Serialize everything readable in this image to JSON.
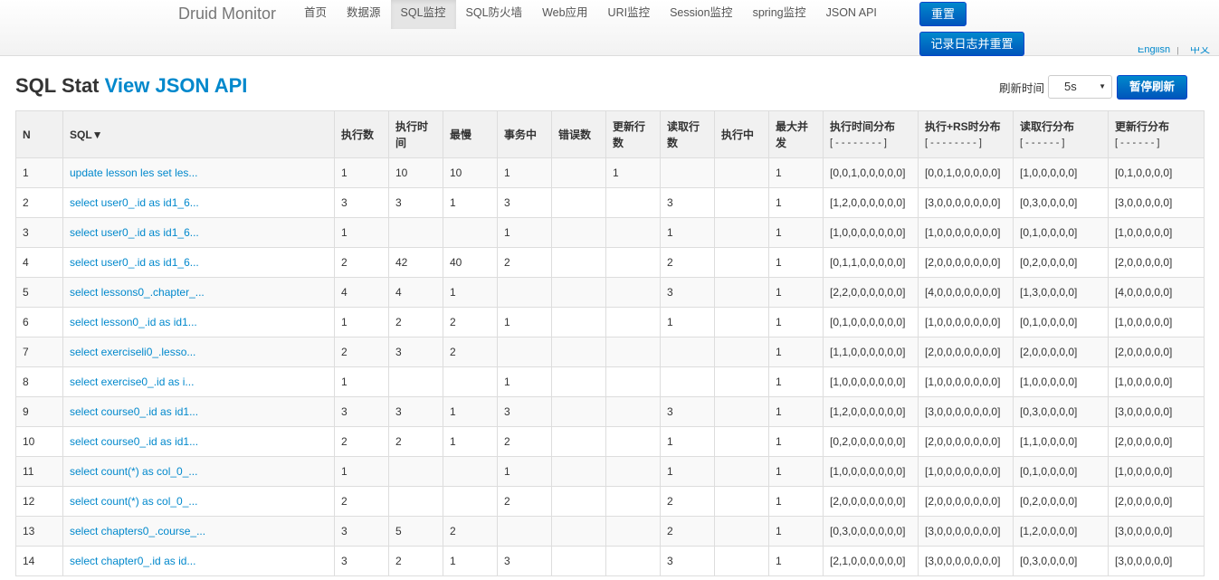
{
  "navbar": {
    "brand": "Druid Monitor",
    "items": [
      "首页",
      "数据源",
      "SQL监控",
      "SQL防火墙",
      "Web应用",
      "URI监控",
      "Session监控",
      "spring监控",
      "JSON API"
    ],
    "active_index": 2,
    "reset_label": "重置",
    "reset_log_label": "记录日志并重置",
    "lang_en": "English",
    "lang_sep": "|",
    "lang_zh": "中文"
  },
  "heading": {
    "title": "SQL Stat",
    "link": "View JSON API"
  },
  "refresh": {
    "label": "刷新时间",
    "selected": "5s",
    "pause_label": "暂停刷新"
  },
  "table": {
    "columns": [
      {
        "label": "N",
        "sub": ""
      },
      {
        "label": "SQL▼",
        "sub": ""
      },
      {
        "label": "执行数",
        "sub": ""
      },
      {
        "label": "执行时间",
        "sub": ""
      },
      {
        "label": "最慢",
        "sub": ""
      },
      {
        "label": "事务中",
        "sub": ""
      },
      {
        "label": "错误数",
        "sub": ""
      },
      {
        "label": "更新行数",
        "sub": ""
      },
      {
        "label": "读取行数",
        "sub": ""
      },
      {
        "label": "执行中",
        "sub": ""
      },
      {
        "label": "最大并发",
        "sub": ""
      },
      {
        "label": "执行时间分布",
        "sub": "[ - - - - - - - - ]"
      },
      {
        "label": "执行+RS时分布",
        "sub": "[ - - - - - - - - ]"
      },
      {
        "label": "读取行分布",
        "sub": "[ - - - - - - ]"
      },
      {
        "label": "更新行分布",
        "sub": "[ - - - - - - ]"
      }
    ],
    "rows": [
      [
        "1",
        "update lesson les set les...",
        "1",
        "10",
        "10",
        "1",
        "",
        "1",
        "",
        "",
        "1",
        "[0,0,1,0,0,0,0,0]",
        "[0,0,1,0,0,0,0,0]",
        "[1,0,0,0,0,0]",
        "[0,1,0,0,0,0]"
      ],
      [
        "2",
        "select user0_.id as id1_6...",
        "3",
        "3",
        "1",
        "3",
        "",
        "",
        "3",
        "",
        "1",
        "[1,2,0,0,0,0,0,0]",
        "[3,0,0,0,0,0,0,0]",
        "[0,3,0,0,0,0]",
        "[3,0,0,0,0,0]"
      ],
      [
        "3",
        "select user0_.id as id1_6...",
        "1",
        "",
        "",
        "1",
        "",
        "",
        "1",
        "",
        "1",
        "[1,0,0,0,0,0,0,0]",
        "[1,0,0,0,0,0,0,0]",
        "[0,1,0,0,0,0]",
        "[1,0,0,0,0,0]"
      ],
      [
        "4",
        "select user0_.id as id1_6...",
        "2",
        "42",
        "40",
        "2",
        "",
        "",
        "2",
        "",
        "1",
        "[0,1,1,0,0,0,0,0]",
        "[2,0,0,0,0,0,0,0]",
        "[0,2,0,0,0,0]",
        "[2,0,0,0,0,0]"
      ],
      [
        "5",
        "select lessons0_.chapter_...",
        "4",
        "4",
        "1",
        "",
        "",
        "",
        "3",
        "",
        "1",
        "[2,2,0,0,0,0,0,0]",
        "[4,0,0,0,0,0,0,0]",
        "[1,3,0,0,0,0]",
        "[4,0,0,0,0,0]"
      ],
      [
        "6",
        "select lesson0_.id as id1...",
        "1",
        "2",
        "2",
        "1",
        "",
        "",
        "1",
        "",
        "1",
        "[0,1,0,0,0,0,0,0]",
        "[1,0,0,0,0,0,0,0]",
        "[0,1,0,0,0,0]",
        "[1,0,0,0,0,0]"
      ],
      [
        "7",
        "select exerciseli0_.lesso...",
        "2",
        "3",
        "2",
        "",
        "",
        "",
        "",
        "",
        "1",
        "[1,1,0,0,0,0,0,0]",
        "[2,0,0,0,0,0,0,0]",
        "[2,0,0,0,0,0]",
        "[2,0,0,0,0,0]"
      ],
      [
        "8",
        "select exercise0_.id as i...",
        "1",
        "",
        "",
        "1",
        "",
        "",
        "",
        "",
        "1",
        "[1,0,0,0,0,0,0,0]",
        "[1,0,0,0,0,0,0,0]",
        "[1,0,0,0,0,0]",
        "[1,0,0,0,0,0]"
      ],
      [
        "9",
        "select course0_.id as id1...",
        "3",
        "3",
        "1",
        "3",
        "",
        "",
        "3",
        "",
        "1",
        "[1,2,0,0,0,0,0,0]",
        "[3,0,0,0,0,0,0,0]",
        "[0,3,0,0,0,0]",
        "[3,0,0,0,0,0]"
      ],
      [
        "10",
        "select course0_.id as id1...",
        "2",
        "2",
        "1",
        "2",
        "",
        "",
        "1",
        "",
        "1",
        "[0,2,0,0,0,0,0,0]",
        "[2,0,0,0,0,0,0,0]",
        "[1,1,0,0,0,0]",
        "[2,0,0,0,0,0]"
      ],
      [
        "11",
        "select count(*) as col_0_...",
        "1",
        "",
        "",
        "1",
        "",
        "",
        "1",
        "",
        "1",
        "[1,0,0,0,0,0,0,0]",
        "[1,0,0,0,0,0,0,0]",
        "[0,1,0,0,0,0]",
        "[1,0,0,0,0,0]"
      ],
      [
        "12",
        "select count(*) as col_0_...",
        "2",
        "",
        "",
        "2",
        "",
        "",
        "2",
        "",
        "1",
        "[2,0,0,0,0,0,0,0]",
        "[2,0,0,0,0,0,0,0]",
        "[0,2,0,0,0,0]",
        "[2,0,0,0,0,0]"
      ],
      [
        "13",
        "select chapters0_.course_...",
        "3",
        "5",
        "2",
        "",
        "",
        "",
        "2",
        "",
        "1",
        "[0,3,0,0,0,0,0,0]",
        "[3,0,0,0,0,0,0,0]",
        "[1,2,0,0,0,0]",
        "[3,0,0,0,0,0]"
      ],
      [
        "14",
        "select chapter0_.id as id...",
        "3",
        "2",
        "1",
        "3",
        "",
        "",
        "3",
        "",
        "1",
        "[2,1,0,0,0,0,0,0]",
        "[3,0,0,0,0,0,0,0]",
        "[0,3,0,0,0,0]",
        "[3,0,0,0,0,0]"
      ]
    ]
  }
}
